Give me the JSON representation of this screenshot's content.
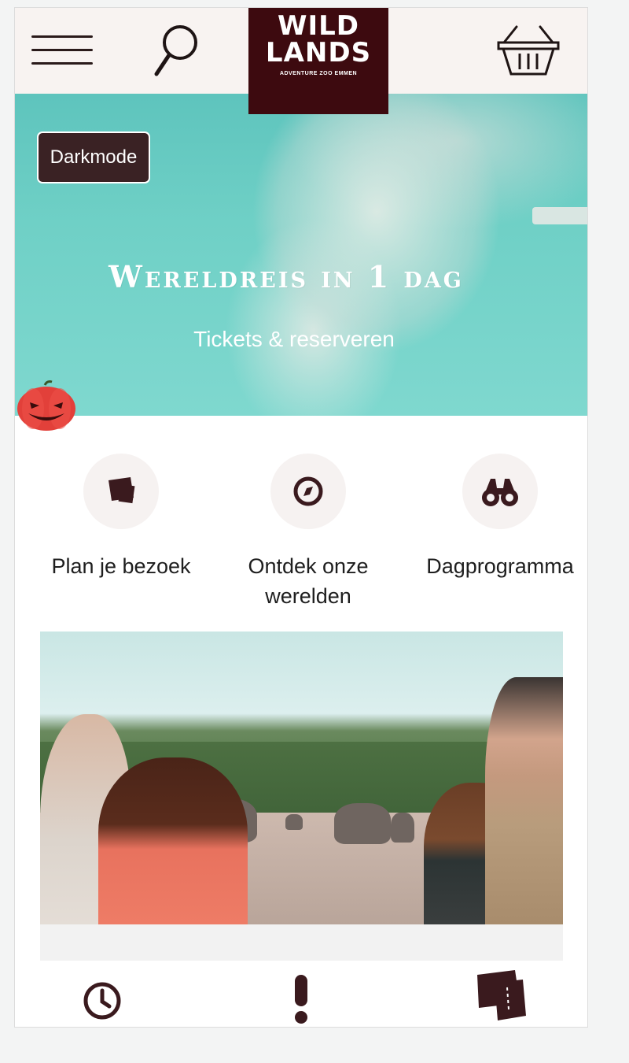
{
  "header": {
    "logo_line1": "WILD",
    "logo_line2": "LANDS",
    "logo_tagline": "ADVENTURE ZOO EMMEN"
  },
  "hero": {
    "darkmode_label": "Darkmode",
    "title": "Wereldreis in 1 dag",
    "link": "Tickets & reserveren"
  },
  "quick_links": [
    {
      "label_line1": "Plan je bezoek",
      "label_line2": "",
      "icon": "ticket-icon"
    },
    {
      "label_line1": "Ontdek onze",
      "label_line2": "werelden",
      "icon": "compass-icon"
    },
    {
      "label_line1": "Dagprogramma",
      "label_line2": "",
      "icon": "binoculars-icon"
    }
  ],
  "bottom_icons": [
    "clock-icon",
    "exclamation-icon",
    "ticket-icon"
  ],
  "colors": {
    "brand": "#3d0a0f",
    "header_bg": "#f8f3f1",
    "icon_dark": "#3a1a1e",
    "darkmode_bg": "#3a2224"
  }
}
